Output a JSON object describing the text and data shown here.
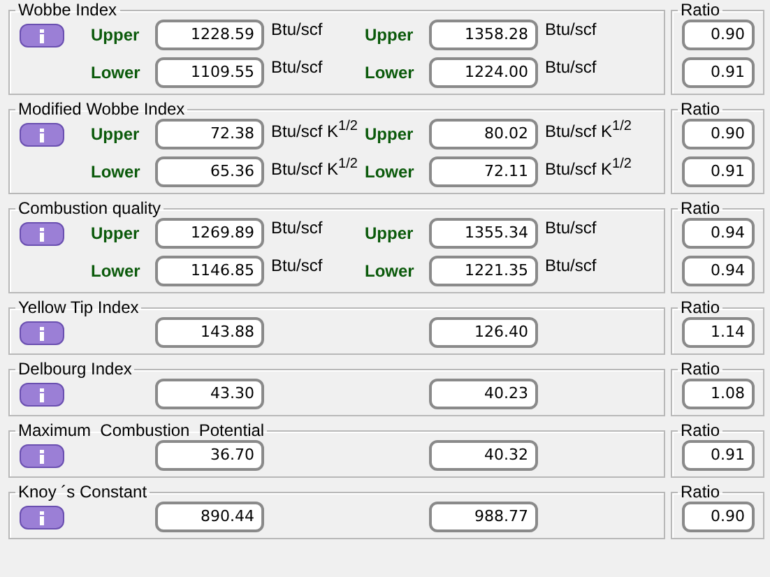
{
  "sections": [
    {
      "title": "Wobbe Index",
      "rows": [
        {
          "left": {
            "label": "Upper",
            "value": "1228.59",
            "unit": "Btu/scf"
          },
          "right": {
            "label": "Upper",
            "value": "1358.28",
            "unit": "Btu/scf"
          }
        },
        {
          "left": {
            "label": "Lower",
            "value": "1109.55",
            "unit": "Btu/scf"
          },
          "right": {
            "label": "Lower",
            "value": "1224.00",
            "unit": "Btu/scf"
          }
        }
      ],
      "ratio_title": "Ratio",
      "ratios": [
        "0.90",
        "0.91"
      ]
    },
    {
      "title": "Modified Wobbe Index",
      "rows": [
        {
          "left": {
            "label": "Upper",
            "value": "72.38",
            "unit": "Btu/scf K$^{1/2}$"
          },
          "right": {
            "label": "Upper",
            "value": "80.02",
            "unit": "Btu/scf K$^{1/2}$"
          }
        },
        {
          "left": {
            "label": "Lower",
            "value": "65.36",
            "unit": "Btu/scf K$^{1/2}$"
          },
          "right": {
            "label": "Lower",
            "value": "72.11",
            "unit": "Btu/scf K$^{1/2}$"
          }
        }
      ],
      "ratio_title": "Ratio",
      "ratios": [
        "0.90",
        "0.91"
      ]
    },
    {
      "title": "Combustion quality",
      "rows": [
        {
          "left": {
            "label": "Upper",
            "value": "1269.89",
            "unit": "Btu/scf"
          },
          "right": {
            "label": "Upper",
            "value": "1355.34",
            "unit": "Btu/scf"
          }
        },
        {
          "left": {
            "label": "Lower",
            "value": "1146.85",
            "unit": "Btu/scf"
          },
          "right": {
            "label": "Lower",
            "value": "1221.35",
            "unit": "Btu/scf"
          }
        }
      ],
      "ratio_title": "Ratio",
      "ratios": [
        "0.94",
        "0.94"
      ]
    },
    {
      "title": "Yellow Tip Index",
      "rows": [
        {
          "left": {
            "value": "143.88"
          },
          "right": {
            "value": "126.40"
          }
        }
      ],
      "ratio_title": "Ratio",
      "ratios": [
        "1.14"
      ]
    },
    {
      "title": "Delbourg Index",
      "rows": [
        {
          "left": {
            "value": "43.30"
          },
          "right": {
            "value": "40.23"
          }
        }
      ],
      "ratio_title": "Ratio",
      "ratios": [
        "1.08"
      ]
    },
    {
      "title": "Maximum  Combustion  Potential",
      "rows": [
        {
          "left": {
            "value": "36.70"
          },
          "right": {
            "value": "40.32"
          }
        }
      ],
      "ratio_title": "Ratio",
      "ratios": [
        "0.91"
      ]
    },
    {
      "title": "Knoy ´s Constant",
      "rows": [
        {
          "left": {
            "value": "890.44"
          },
          "right": {
            "value": "988.77"
          }
        }
      ],
      "ratio_title": "Ratio",
      "ratios": [
        "0.90"
      ]
    }
  ]
}
